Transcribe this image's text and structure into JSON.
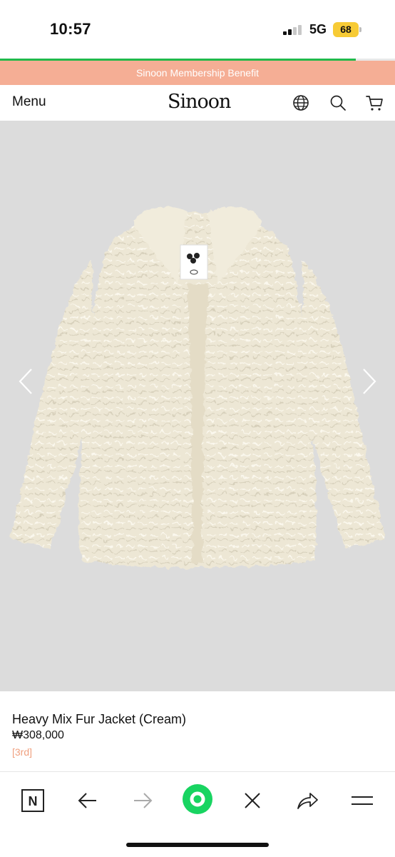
{
  "status": {
    "time": "10:57",
    "network": "5G",
    "battery": "68"
  },
  "page_load_progress": 0.9,
  "banner": {
    "text": "Sinoon Membership Benefit"
  },
  "header": {
    "menu_label": "Menu",
    "logo_text": "Sinoon",
    "icons": [
      "globe-icon",
      "search-icon",
      "cart-icon"
    ]
  },
  "product": {
    "name": "Heavy Mix Fur Jacket (Cream)",
    "price": "₩308,000",
    "tag": "[3rd]"
  },
  "toolbar": {
    "icons": [
      "naver-n-icon",
      "back-arrow-icon",
      "forward-arrow-icon",
      "green-home-icon",
      "close-icon",
      "share-icon",
      "hamburger-menu-icon"
    ]
  },
  "colors": {
    "banner_bg": "#f5ae95",
    "progress": "#21b94b",
    "tag": "#f0a07f",
    "image_bg": "#dcdcdc",
    "jacket": "#ece6d4",
    "home_button": "#18d461"
  }
}
